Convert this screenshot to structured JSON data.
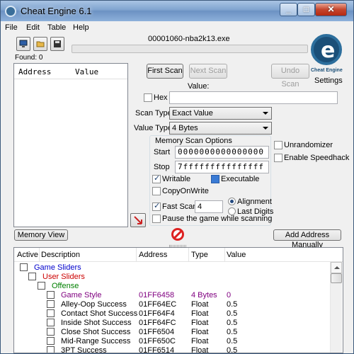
{
  "window": {
    "title": "Cheat Engine 6.1"
  },
  "menu": [
    "File",
    "Edit",
    "Table",
    "Help"
  ],
  "process": "00001060-nba2k13.exe",
  "found": "Found: 0",
  "logo_text": "Cheat Engine",
  "settings_label": "Settings",
  "results": {
    "col_address": "Address",
    "col_value": "Value"
  },
  "scan": {
    "first_scan": "First Scan",
    "next_scan": "Next Scan",
    "undo_scan": "Undo Scan",
    "value_label": "Value:",
    "hex_label": "Hex",
    "scan_type_label": "Scan Type",
    "scan_type_value": "Exact Value",
    "value_type_label": "Value Type",
    "value_type_value": "4 Bytes",
    "memory_options_title": "Memory Scan Options",
    "start_label": "Start",
    "start_value": "0000000000000000",
    "stop_label": "Stop",
    "stop_value": "7fffffffffffffff",
    "writable": "Writable",
    "executable": "Executable",
    "copyonwrite": "CopyOnWrite",
    "fast_scan": "Fast Scan",
    "fast_scan_value": "4",
    "alignment": "Alignment",
    "last_digits": "Last Digits",
    "pause_game": "Pause the game while scanning",
    "unrandomizer": "Unrandomizer",
    "speedhack": "Enable Speedhack"
  },
  "memory_view": "Memory View",
  "add_manual": "Add Address Manually",
  "table": {
    "headers": [
      "Active",
      "Description",
      "Address",
      "Type",
      "Value"
    ],
    "rows": [
      {
        "desc": "Game Sliders",
        "address": "",
        "type": "",
        "value": "",
        "color": "#0000cc"
      },
      {
        "desc": "User Sliders",
        "address": "",
        "type": "",
        "value": "",
        "color": "#cc0000"
      },
      {
        "desc": "Offense",
        "address": "",
        "type": "",
        "value": "",
        "color": "#008000"
      },
      {
        "desc": "Game Style",
        "address": "01FF6458",
        "type": "4 Bytes",
        "value": "0",
        "color": "#800080"
      },
      {
        "desc": "Alley-Oop Success",
        "address": "01FF64EC",
        "type": "Float",
        "value": "0.5",
        "color": "#000000"
      },
      {
        "desc": "Contact Shot Success",
        "address": "01FF64F4",
        "type": "Float",
        "value": "0.5",
        "color": "#000000"
      },
      {
        "desc": "Inside Shot Success",
        "address": "01FF64FC",
        "type": "Float",
        "value": "0.5",
        "color": "#000000"
      },
      {
        "desc": "Close Shot Success",
        "address": "01FF6504",
        "type": "Float",
        "value": "0.5",
        "color": "#000000"
      },
      {
        "desc": "Mid-Range Success",
        "address": "01FF650C",
        "type": "Float",
        "value": "0.5",
        "color": "#000000"
      },
      {
        "desc": "3PT Success",
        "address": "01FF6514",
        "type": "Float",
        "value": "0.5",
        "color": "#000000"
      }
    ]
  }
}
